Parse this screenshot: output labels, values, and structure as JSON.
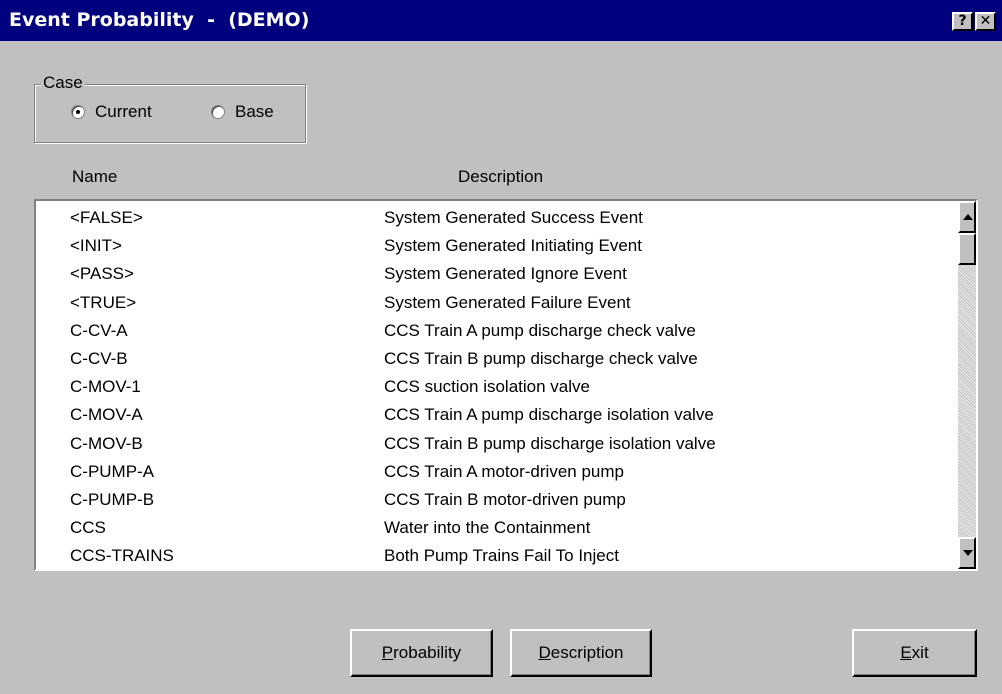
{
  "window": {
    "title": "Event Probability  -  (DEMO)",
    "help_label": "?",
    "close_label": "✕"
  },
  "case_group": {
    "legend": "Case",
    "options": [
      {
        "label": "Current",
        "selected": true
      },
      {
        "label": "Base",
        "selected": false
      }
    ]
  },
  "columns": {
    "name": "Name",
    "description": "Description"
  },
  "rows": [
    {
      "name": "<FALSE>",
      "description": "System Generated Success Event"
    },
    {
      "name": "<INIT>",
      "description": "System Generated Initiating Event"
    },
    {
      "name": "<PASS>",
      "description": "System Generated Ignore Event"
    },
    {
      "name": "<TRUE>",
      "description": "System Generated Failure Event"
    },
    {
      "name": "C-CV-A",
      "description": "CCS Train A pump discharge check valve"
    },
    {
      "name": "C-CV-B",
      "description": "CCS Train B pump discharge check valve"
    },
    {
      "name": "C-MOV-1",
      "description": "CCS suction isolation valve"
    },
    {
      "name": "C-MOV-A",
      "description": "CCS Train A pump discharge isolation valve"
    },
    {
      "name": "C-MOV-B",
      "description": "CCS Train B pump discharge isolation valve"
    },
    {
      "name": "C-PUMP-A",
      "description": "CCS Train A motor-driven pump"
    },
    {
      "name": "C-PUMP-B",
      "description": "CCS Train B motor-driven pump"
    },
    {
      "name": "CCS",
      "description": "Water into the Containment"
    },
    {
      "name": "CCS-TRAINS",
      "description": "Both Pump Trains Fail To Inject"
    }
  ],
  "buttons": {
    "probability": {
      "mnemonic": "P",
      "rest": "robability"
    },
    "description": {
      "mnemonic": "D",
      "rest": "escription"
    },
    "exit": {
      "mnemonic": "E",
      "rest": "xit"
    }
  }
}
